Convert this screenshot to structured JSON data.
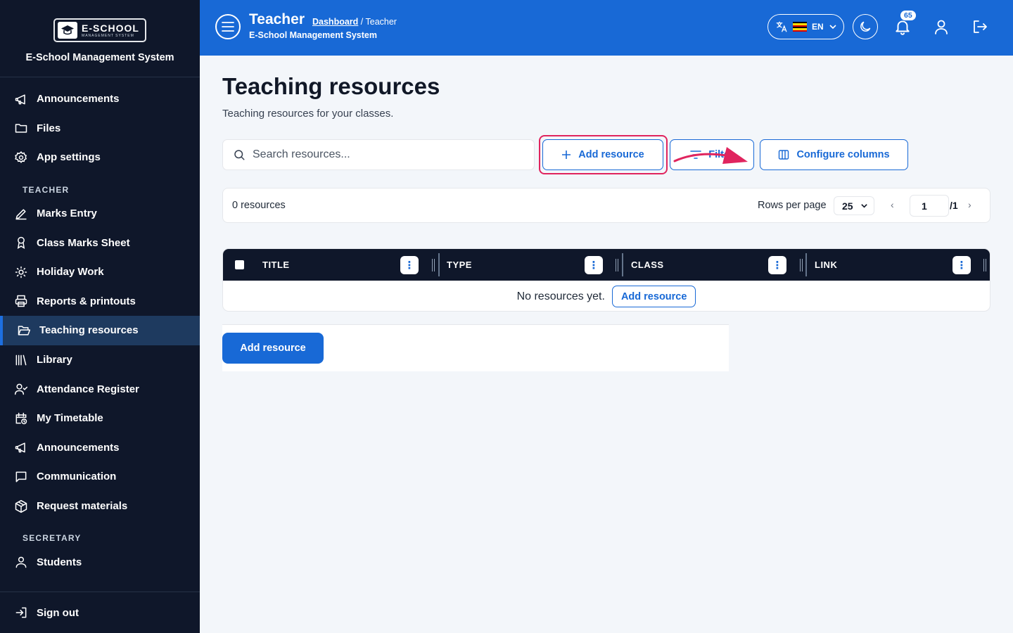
{
  "brand": {
    "logo_text": "E-SCHOOL",
    "logo_sub": "MANAGEMENT SYSTEM",
    "title": "E-School Management System"
  },
  "sidebar": {
    "top_items": [
      {
        "label": "Announcements",
        "icon": "megaphone-icon"
      },
      {
        "label": "Files",
        "icon": "folder-icon"
      },
      {
        "label": "App settings",
        "icon": "gear-icon"
      }
    ],
    "teacher_section": "TEACHER",
    "teacher_items": [
      {
        "label": "Marks Entry",
        "icon": "pen-icon"
      },
      {
        "label": "Class Marks Sheet",
        "icon": "award-icon"
      },
      {
        "label": "Holiday Work",
        "icon": "sun-icon"
      },
      {
        "label": "Reports & printouts",
        "icon": "printer-icon"
      },
      {
        "label": "Teaching resources",
        "icon": "folder-open-icon",
        "active": true
      },
      {
        "label": "Library",
        "icon": "library-icon"
      },
      {
        "label": "Attendance Register",
        "icon": "user-check-icon"
      },
      {
        "label": "My Timetable",
        "icon": "calendar-clock-icon"
      },
      {
        "label": "Announcements",
        "icon": "megaphone-icon"
      },
      {
        "label": "Communication",
        "icon": "message-square-icon"
      },
      {
        "label": "Request materials",
        "icon": "package-icon"
      }
    ],
    "secretary_section": "SECRETARY",
    "secretary_items": [
      {
        "label": "Students",
        "icon": "user-icon"
      }
    ],
    "sign_out": "Sign out"
  },
  "topbar": {
    "title": "Teacher",
    "breadcrumb_link": "Dashboard",
    "breadcrumb_sep": " / ",
    "breadcrumb_current": "Teacher",
    "subtitle": "E-School Management System",
    "language": "EN",
    "notification_count": "65",
    "accent": "#1869d6"
  },
  "main": {
    "title": "Teaching resources",
    "subtitle": "Teaching resources for your classes.",
    "search_placeholder": "Search resources...",
    "add_button": "Add resource",
    "filter_button": "Filter",
    "configure_button": "Configure columns",
    "count": "0 resources",
    "rows_per_page_label": "Rows per page",
    "rows_per_page": "25",
    "page_current": "1",
    "page_total": "/1",
    "columns": [
      "TITLE",
      "TYPE",
      "CLASS",
      "LINK"
    ],
    "empty_text": "No resources yet.",
    "empty_button": "Add resource",
    "primary_button": "Add resource"
  }
}
